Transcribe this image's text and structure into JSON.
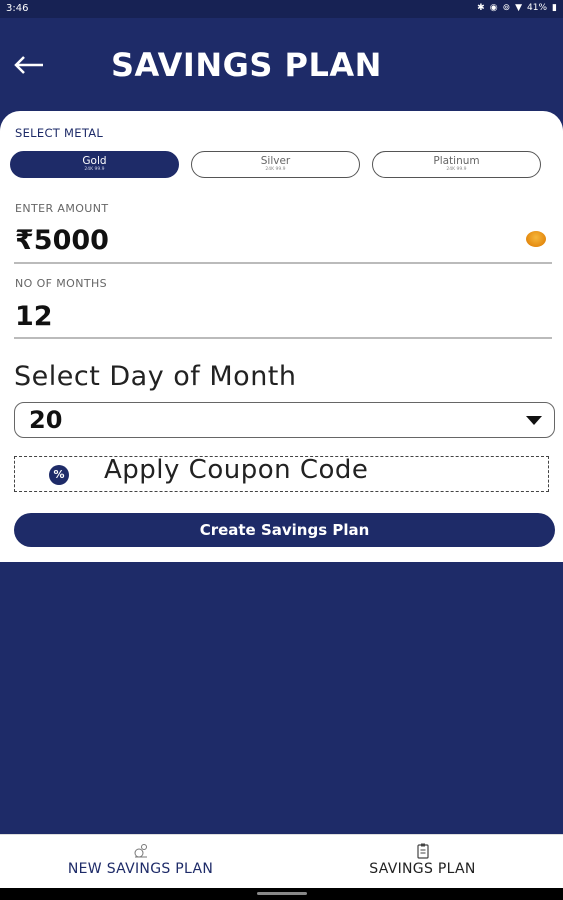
{
  "status_bar": {
    "time": "3:46",
    "battery": "41%"
  },
  "header": {
    "title": "SAVINGS PLAN"
  },
  "metal": {
    "label": "SELECT METAL",
    "options": [
      {
        "name": "Gold",
        "sub": "24K 99.9",
        "selected": true
      },
      {
        "name": "Silver",
        "sub": "24K 99.9",
        "selected": false
      },
      {
        "name": "Platinum",
        "sub": "24K 99.9",
        "selected": false
      }
    ]
  },
  "amount": {
    "label": "ENTER AMOUNT",
    "value": "₹5000"
  },
  "months": {
    "label": "NO OF MONTHS",
    "value": "12"
  },
  "day": {
    "title": "Select Day of Month",
    "selected": "20"
  },
  "coupon": {
    "label": "Apply Coupon Code"
  },
  "create_button": {
    "label": "Create Savings Plan"
  },
  "bottom_nav": {
    "items": [
      {
        "label": "NEW SAVINGS PLAN",
        "icon": "piggy-icon"
      },
      {
        "label": "SAVINGS PLAN",
        "icon": "clipboard-icon"
      }
    ]
  },
  "colors": {
    "primary": "#1e2b68",
    "coin": "#e48a10"
  }
}
